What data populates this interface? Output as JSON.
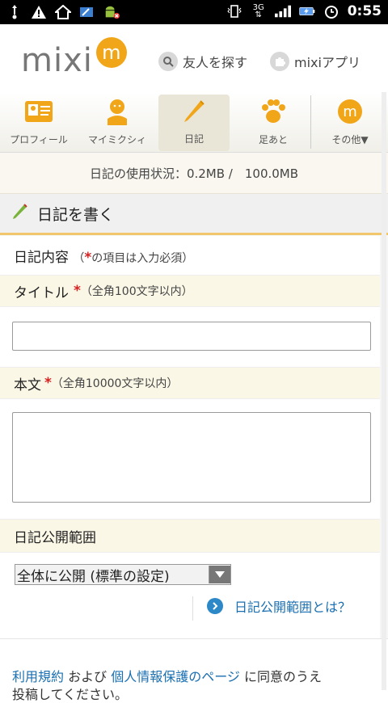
{
  "status_bar": {
    "time": "0:55",
    "network": "3G",
    "left_icons": [
      "usb-icon",
      "warning-icon",
      "home-icon",
      "download-icon",
      "android-icon"
    ],
    "right_icons": [
      "vibrate-icon",
      "network-3g-icon",
      "signal-icon",
      "battery-icon",
      "alarm-icon"
    ]
  },
  "header": {
    "logo_text": "mixi",
    "logo_badge": "m",
    "find_friends": "友人を探す",
    "apps": "mixiアプリ"
  },
  "nav": {
    "items": [
      {
        "label": "プロフィール",
        "icon": "profile-card-icon"
      },
      {
        "label": "マイミクシィ",
        "icon": "person-icon"
      },
      {
        "label": "日記",
        "icon": "pencil-icon"
      },
      {
        "label": "足あと",
        "icon": "paw-icon"
      },
      {
        "label": "その他▼",
        "icon": "mixi-badge-icon"
      }
    ],
    "active_index": 2
  },
  "usage": {
    "text": "日記の使用状況：0.2MB /　100.0MB"
  },
  "page_title": "日記を書く",
  "form": {
    "content_label": "日記内容",
    "required_note_prefix": "（",
    "required_mark": "*",
    "required_note_text": "の項目は入力必須）",
    "title_label": "タイトル",
    "title_note": "（全角100文字以内）",
    "title_value": "",
    "body_label": "本文",
    "body_note": "（全角10000文字以内）",
    "body_value": "",
    "visibility_label": "日記公開範囲",
    "visibility_selected": "全体に公開 (標準の設定)",
    "visibility_help": "日記公開範囲とは？"
  },
  "footer": {
    "terms_link": "利用規約",
    "and_text": " および ",
    "privacy_link": "個人情報保護のページ",
    "agree_text": " に同意のうえ",
    "line2": "投稿してください。"
  },
  "colors": {
    "accent_orange": "#f1a619",
    "link_blue": "#1a6fb0",
    "required_red": "#d71f1f",
    "title_underline": "#f2c66a"
  }
}
